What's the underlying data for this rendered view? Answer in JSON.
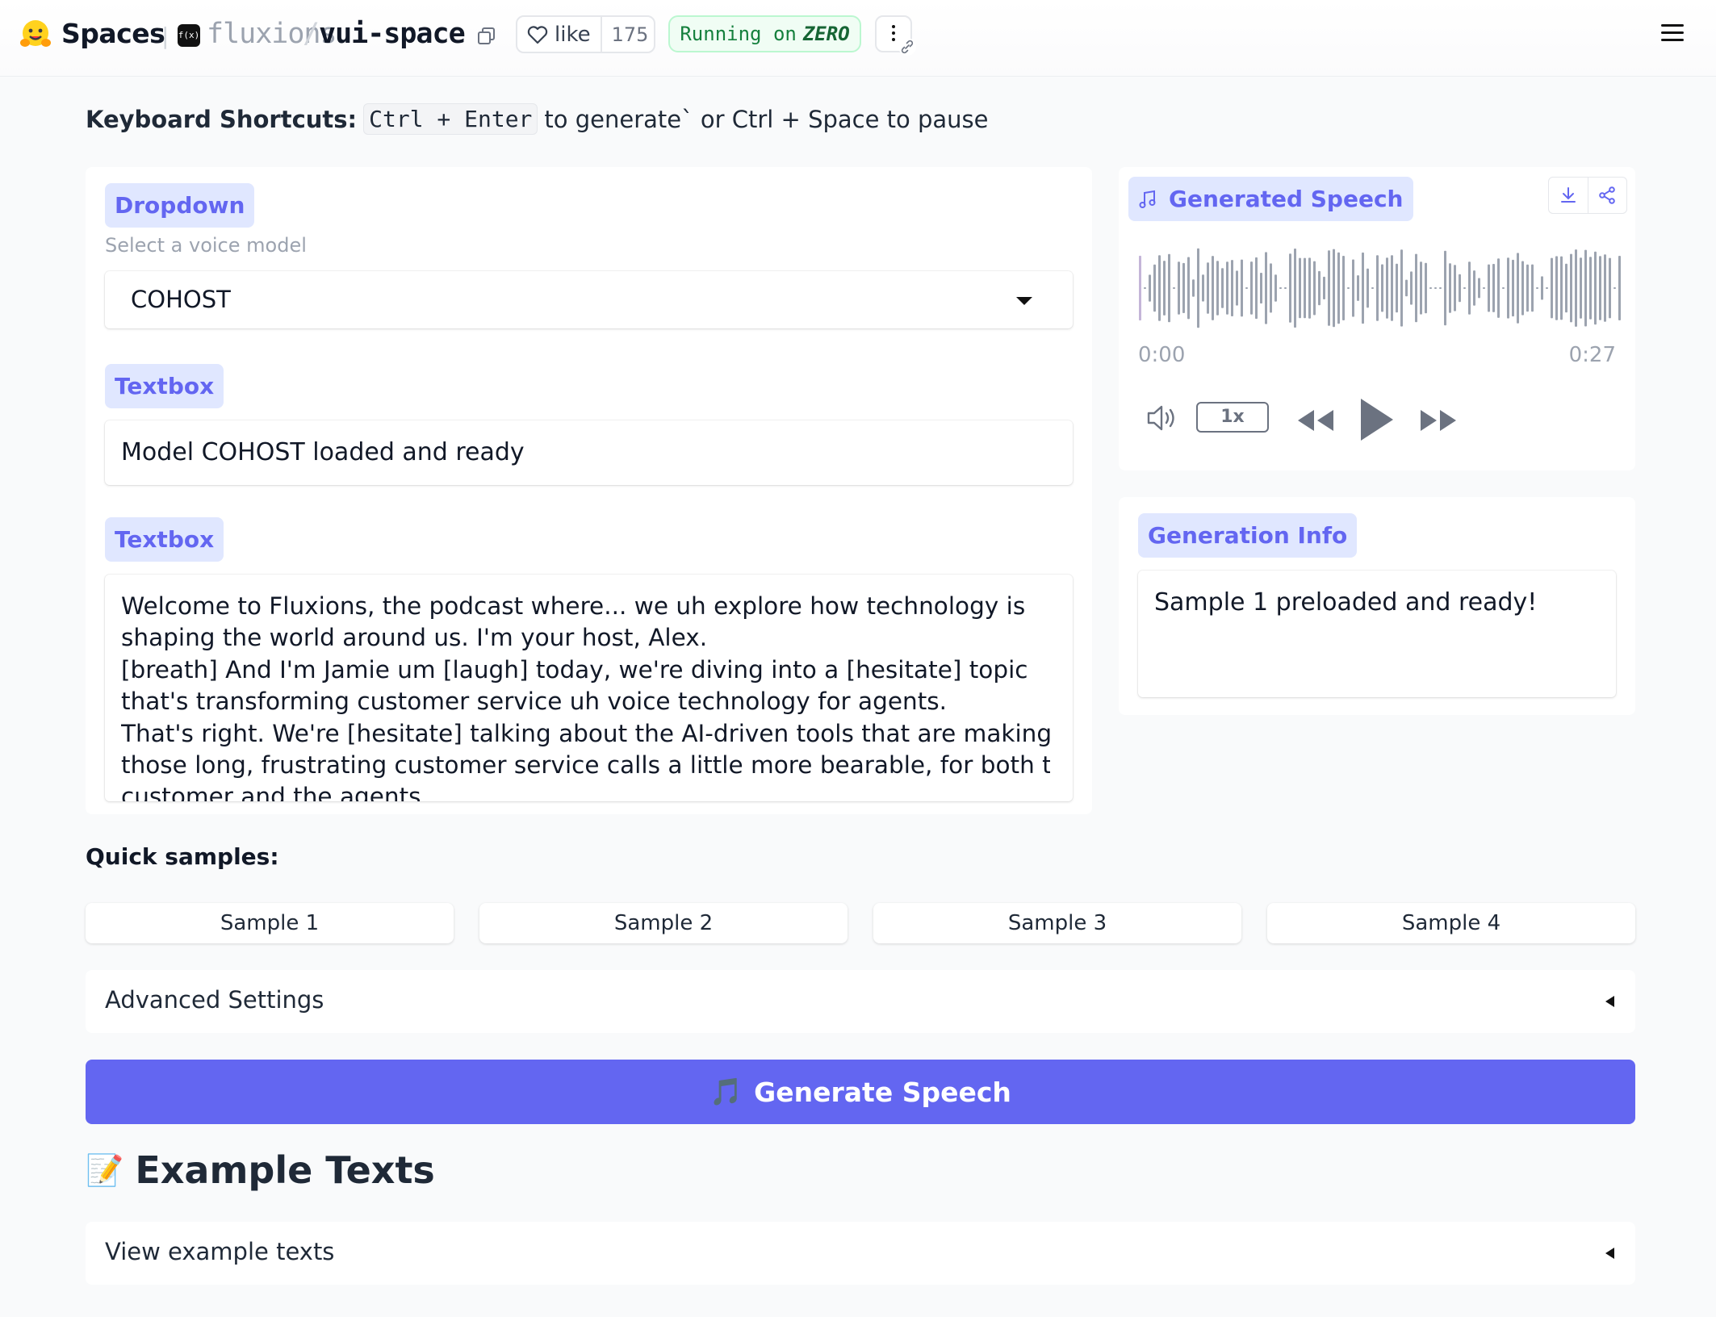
{
  "header": {
    "spaces_label": "Spaces",
    "owner": "fluxions",
    "separator": "/",
    "repo": "vui-space",
    "avatar_text": "f(x)",
    "like_label": "like",
    "like_count": "175",
    "running_prefix": "Running on",
    "running_hardware": "ZERO"
  },
  "shortcuts": {
    "label": "Keyboard Shortcuts:",
    "key_combo": "Ctrl + Enter",
    "text": "to generate` or Ctrl + Space to pause"
  },
  "voice_dropdown": {
    "badge": "Dropdown",
    "info": "Select a voice model",
    "value": "COHOST"
  },
  "status_textbox": {
    "badge": "Textbox",
    "value": "Model COHOST loaded and ready"
  },
  "input_textbox": {
    "badge": "Textbox",
    "lines": [
      "Welcome to Fluxions, the podcast where... we uh explore how technology is",
      "shaping the world around us. I'm your host, Alex.",
      "[breath] And I'm Jamie um [laugh] today, we're diving into a [hesitate] topic",
      "that's transforming customer service uh voice technology for agents.",
      "That's right. We're [hesitate] talking about the AI-driven tools that are making",
      "those long, frustrating customer service calls a little more bearable, for both the",
      "customer and the agents."
    ]
  },
  "audio": {
    "badge": "Generated Speech",
    "time_current": "0:00",
    "time_total": "0:27",
    "playback_rate": "1x",
    "progress": 0
  },
  "generation_info": {
    "badge": "Generation Info",
    "value": "Sample 1 preloaded and ready!"
  },
  "quick_samples": {
    "label": "Quick samples:",
    "buttons": [
      "Sample 1",
      "Sample 2",
      "Sample 3",
      "Sample 4"
    ]
  },
  "advanced_settings": {
    "label": "Advanced Settings"
  },
  "generate_button": {
    "icon": "🎵",
    "label": "Generate Speech"
  },
  "example_texts": {
    "icon": "📝",
    "title": "Example Texts",
    "accordion_label": "View example texts"
  },
  "colors": {
    "accent": "#6366f1",
    "badge_bg": "#e0e7ff",
    "running_green": "#15803d"
  }
}
